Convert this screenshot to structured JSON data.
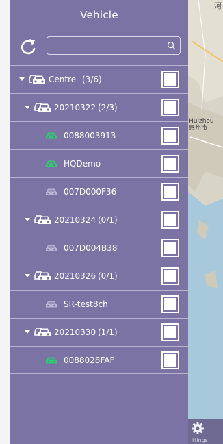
{
  "header": {
    "title": "Vehicle"
  },
  "search": {
    "placeholder": "",
    "value": ""
  },
  "map": {
    "top_label": "河",
    "city_label_1": "Huizhou",
    "city_label_2": "惠州市",
    "toolbar_label": "ttings"
  },
  "colors": {
    "drawer_bg": "#7a73a4",
    "online_car": "#2ecc71",
    "offline_car": "#b9b5d4",
    "group_icon": "#ffffff"
  },
  "tree": [
    {
      "kind": "group",
      "level": 0,
      "name": "Centre",
      "count": "(3/6)",
      "expanded": true,
      "checked": false
    },
    {
      "kind": "group",
      "level": 1,
      "name": "20210322",
      "count": "(2/3)",
      "expanded": true,
      "checked": false
    },
    {
      "kind": "vehicle",
      "name": "0088003913",
      "status": "online",
      "checked": false
    },
    {
      "kind": "vehicle",
      "name": "HQDemo",
      "status": "online",
      "checked": false
    },
    {
      "kind": "vehicle",
      "name": "007D000F36",
      "status": "offline",
      "checked": false
    },
    {
      "kind": "group",
      "level": 1,
      "name": "20210324",
      "count": "(0/1)",
      "expanded": true,
      "checked": false
    },
    {
      "kind": "vehicle",
      "name": "007D004B38",
      "status": "offline",
      "checked": false
    },
    {
      "kind": "group",
      "level": 1,
      "name": "20210326",
      "count": "(0/1)",
      "expanded": true,
      "checked": false
    },
    {
      "kind": "vehicle",
      "name": "SR-test8ch",
      "status": "offline",
      "checked": false
    },
    {
      "kind": "group",
      "level": 1,
      "name": "20210330",
      "count": "(1/1)",
      "expanded": true,
      "checked": false
    },
    {
      "kind": "vehicle",
      "name": "0088028FAF",
      "status": "online",
      "checked": false
    }
  ]
}
